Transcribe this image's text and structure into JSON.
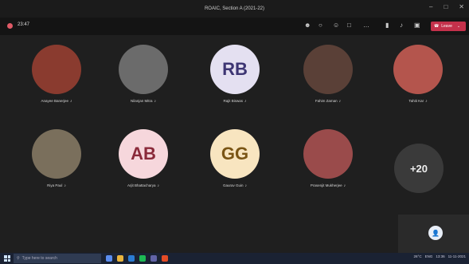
{
  "window": {
    "title": "ROAIC, Section A (2021-22)",
    "controls": [
      "–",
      "□",
      "✕"
    ]
  },
  "meeting": {
    "timer": "23:47",
    "leave_label": "Leave",
    "toolbar_icons": [
      "people-icon",
      "chat-icon",
      "reactions-icon",
      "share-icon",
      "more-icon",
      "camera-icon",
      "mic-icon",
      "share-screen-icon"
    ]
  },
  "participants": [
    {
      "name": "Anayee Banerjee",
      "initials": "",
      "bg": "#8a3b2f"
    },
    {
      "name": "Nilanjan Mitra",
      "initials": "",
      "bg": "#6b6b6b"
    },
    {
      "name": "Rajit Biswas",
      "initials": "RB",
      "bg": "#e4e0f1",
      "fg": "#3d3573"
    },
    {
      "name": "Fahim Zaman",
      "initials": "",
      "bg": "#5a4037"
    },
    {
      "name": "Tahiti Kar",
      "initials": "",
      "bg": "#b4554d"
    },
    {
      "name": "Riya Paul",
      "initials": "",
      "bg": "#7a6f5c"
    },
    {
      "name": "Arjit Bhattacharya",
      "initials": "AB",
      "bg": "#f6d7dc",
      "fg": "#8a2a3a"
    },
    {
      "name": "Gaurav Guin",
      "initials": "GG",
      "bg": "#f8e5c0",
      "fg": "#7a5515"
    },
    {
      "name": "Prasenjit Mukherjee",
      "initials": "",
      "bg": "#9a4b4b"
    }
  ],
  "more_participants": "+20",
  "self_view_initial": "👤",
  "taskbar": {
    "search_placeholder": "Type here to search",
    "temperature": "26°C",
    "clock": "13:36",
    "date": "11-11-2021",
    "lang": "ENG"
  }
}
